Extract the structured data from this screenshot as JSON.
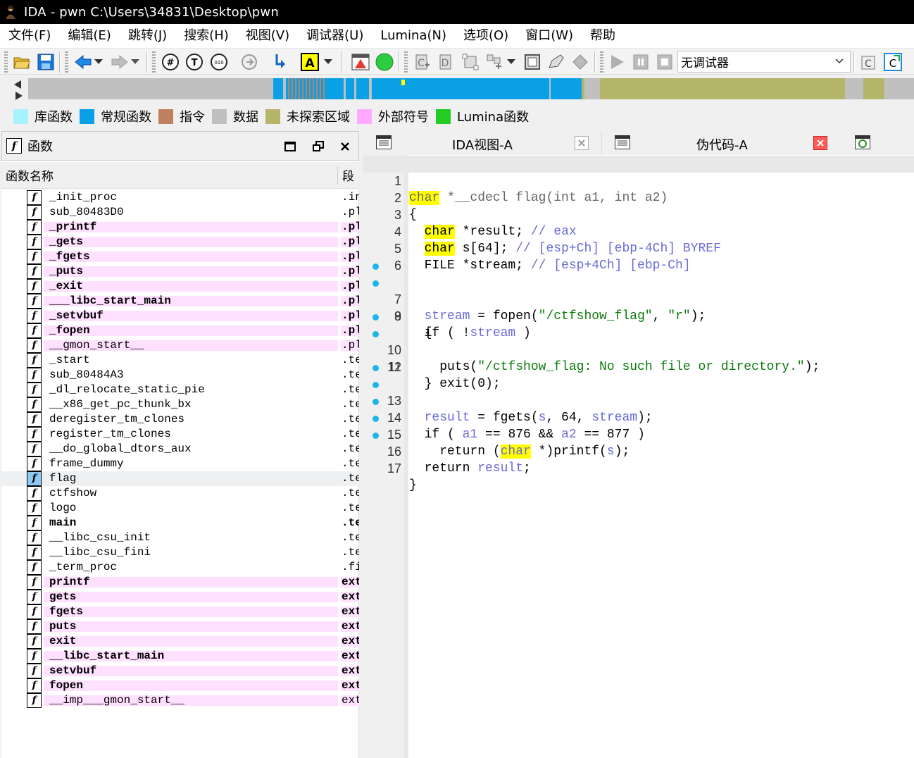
{
  "window": {
    "title": "IDA - pwn C:\\Users\\34831\\Desktop\\pwn"
  },
  "menu": [
    "文件(F)",
    "编辑(E)",
    "跳转(J)",
    "搜索(H)",
    "视图(V)",
    "调试器(U)",
    "Lumina(N)",
    "选项(O)",
    "窗口(W)",
    "帮助"
  ],
  "toolbar": {
    "debugger_select": "无调试器"
  },
  "legend": [
    {
      "label": "库函数",
      "color": "#a6f2ff"
    },
    {
      "label": "常规函数",
      "color": "#0aa0e6"
    },
    {
      "label": "指令",
      "color": "#c08060"
    },
    {
      "label": "数据",
      "color": "#c0c0c0"
    },
    {
      "label": "未探索区域",
      "color": "#b5b56a"
    },
    {
      "label": "外部符号",
      "color": "#ffaaff"
    },
    {
      "label": "Lumina函数",
      "color": "#22cc22"
    }
  ],
  "functions_panel": {
    "title": "函数",
    "col_name": "函数名称",
    "col_segment": "段",
    "rows": [
      {
        "name": "_init_proc",
        "segment": ".init"
      },
      {
        "name": "sub_80483D0",
        "segment": ".plt"
      },
      {
        "name": "_printf",
        "segment": ".plt"
      },
      {
        "name": "_gets",
        "segment": ".plt"
      },
      {
        "name": "_fgets",
        "segment": ".plt"
      },
      {
        "name": "_puts",
        "segment": ".plt"
      },
      {
        "name": "_exit",
        "segment": ".plt"
      },
      {
        "name": "___libc_start_main",
        "segment": ".plt"
      },
      {
        "name": "_setvbuf",
        "segment": ".plt"
      },
      {
        "name": "_fopen",
        "segment": ".plt"
      },
      {
        "name": "__gmon_start__",
        "segment": ".plt"
      },
      {
        "name": "_start",
        "segment": ".text"
      },
      {
        "name": "sub_80484A3",
        "segment": ".text"
      },
      {
        "name": "_dl_relocate_static_pie",
        "segment": ".text"
      },
      {
        "name": "__x86_get_pc_thunk_bx",
        "segment": ".text"
      },
      {
        "name": "deregister_tm_clones",
        "segment": ".text"
      },
      {
        "name": "register_tm_clones",
        "segment": ".text"
      },
      {
        "name": "__do_global_dtors_aux",
        "segment": ".text"
      },
      {
        "name": "frame_dummy",
        "segment": ".text"
      },
      {
        "name": "flag",
        "segment": ".text"
      },
      {
        "name": "ctfshow",
        "segment": ".text"
      },
      {
        "name": "logo",
        "segment": ".text"
      },
      {
        "name": "main",
        "segment": ".text"
      },
      {
        "name": "__libc_csu_init",
        "segment": ".text"
      },
      {
        "name": "__libc_csu_fini",
        "segment": ".text"
      },
      {
        "name": "_term_proc",
        "segment": ".fini"
      },
      {
        "name": "printf",
        "segment": "extern"
      },
      {
        "name": "gets",
        "segment": "extern"
      },
      {
        "name": "fgets",
        "segment": "extern"
      },
      {
        "name": "puts",
        "segment": "extern"
      },
      {
        "name": "exit",
        "segment": "extern"
      },
      {
        "name": "__libc_start_main",
        "segment": "extern"
      },
      {
        "name": "setvbuf",
        "segment": "extern"
      },
      {
        "name": "fopen",
        "segment": "extern"
      },
      {
        "name": "__imp___gmon_start__",
        "segment": "extern"
      }
    ]
  },
  "tabs": [
    {
      "label": "IDA视图-A"
    },
    {
      "label": "伪代码-A"
    }
  ],
  "pseudocode": {
    "line_numbers": [
      "1",
      "2",
      "3",
      "4",
      "5",
      "6",
      "7",
      "8",
      "9",
      "10",
      "11",
      "12",
      "13",
      "14",
      "15",
      "16",
      "17"
    ],
    "l1": {
      "kw": "char",
      "rest": " *__cdecl flag(int a1, int a2)"
    },
    "l2": "{",
    "l3": {
      "kw": "char",
      "code": " *result; ",
      "comment": "// eax"
    },
    "l4": {
      "kw": "char",
      "code": " s[64]; ",
      "comment": "// [esp+Ch] [ebp-4Ch] BYREF"
    },
    "l5": {
      "code": "  FILE *stream; ",
      "comment": "// [esp+4Ch] [ebp-Ch]"
    },
    "l7": {
      "v1": "stream",
      "a": " = fopen(",
      "s1": "\"/ctfshow_flag\"",
      "b": ", ",
      "s2": "\"r\"",
      "c": ");"
    },
    "l8": {
      "a": "  if ( !",
      "v": "stream",
      "b": " )"
    },
    "l9": "  {",
    "l10": {
      "a": "    puts(",
      "s": "\"/ctfshow_flag: No such file or directory.\"",
      "b": ");"
    },
    "l11": "    exit(0);",
    "l12": "  }",
    "l13": {
      "v1": "result",
      "a": " = fgets(",
      "v2": "s",
      "b": ", 64, ",
      "v3": "stream",
      "c": ");"
    },
    "l14": {
      "a": "  if ( ",
      "v1": "a1",
      "b": " == 876 && ",
      "v2": "a2",
      "c": " == 877 )"
    },
    "l15": {
      "a": "    return (",
      "kw": "char",
      "b": " *)printf(",
      "v": "s",
      "c": ");"
    },
    "l16": {
      "a": "  return ",
      "v": "result",
      "b": ";"
    },
    "l17": "}"
  }
}
